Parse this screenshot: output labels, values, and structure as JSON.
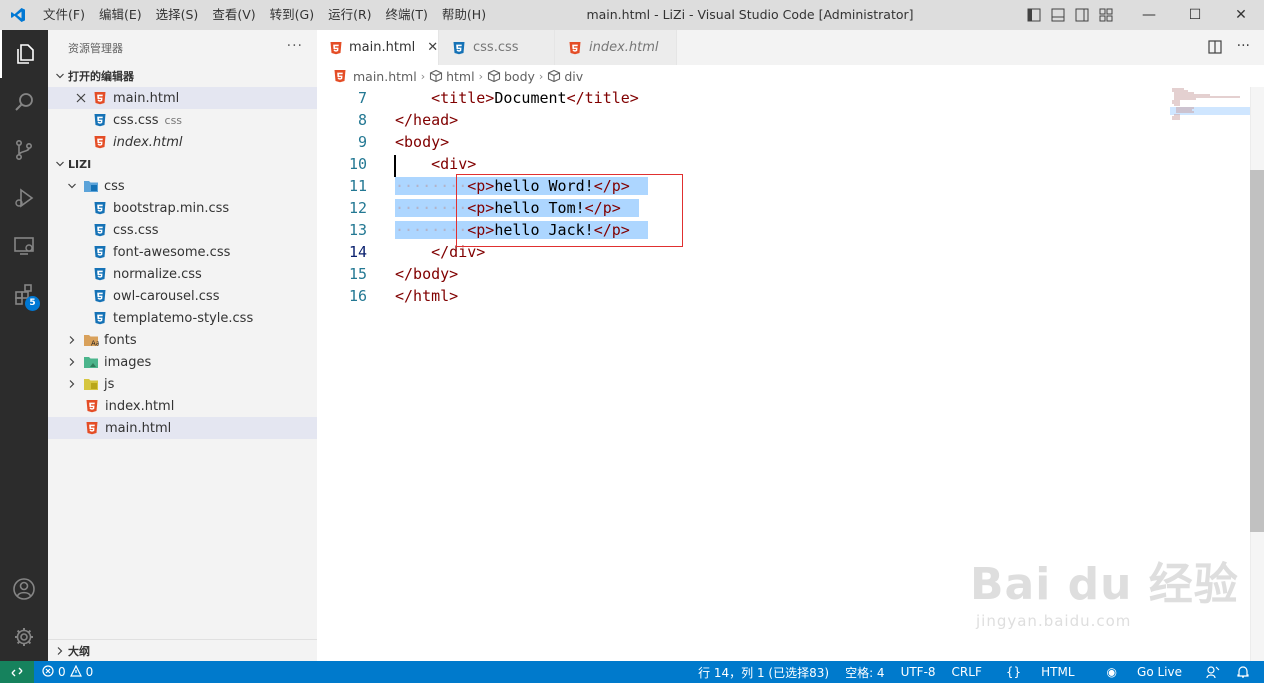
{
  "titlebar": {
    "menu": [
      "文件(F)",
      "编辑(E)",
      "选择(S)",
      "查看(V)",
      "转到(G)",
      "运行(R)",
      "终端(T)",
      "帮助(H)"
    ],
    "title": "main.html - LiZi - Visual Studio Code [Administrator]"
  },
  "activity": {
    "extensions_badge": "5"
  },
  "sidebar": {
    "header": "资源管理器",
    "open_editors_title": "打开的编辑器",
    "open_editors": [
      {
        "name": "main.html",
        "desc": ""
      },
      {
        "name": "css.css",
        "desc": "css"
      },
      {
        "name": "index.html",
        "desc": ""
      }
    ],
    "project_title": "LIZI",
    "tree": {
      "css_folder": "css",
      "css_files": [
        "bootstrap.min.css",
        "css.css",
        "font-awesome.css",
        "normalize.css",
        "owl-carousel.css",
        "templatemo-style.css"
      ],
      "folders": [
        "fonts",
        "images",
        "js"
      ],
      "files": [
        "index.html",
        "main.html"
      ]
    },
    "outline_title": "大纲"
  },
  "tabs": [
    {
      "label": "main.html"
    },
    {
      "label": "css.css"
    },
    {
      "label": "index.html"
    }
  ],
  "breadcrumb": [
    "main.html",
    "html",
    "body",
    "div"
  ],
  "editor": {
    "line_numbers": [
      "7",
      "8",
      "9",
      "10",
      "11",
      "12",
      "13",
      "14",
      "15",
      "16"
    ],
    "lines": {
      "l7_open": "<title>",
      "l7_text": "Document",
      "l7_close": "</title>",
      "l8": "</head>",
      "l9": "<body>",
      "l10": "<div>",
      "l11_open": "<p>",
      "l11_text": "hello Word!",
      "l11_close": "</p>",
      "l12_open": "<p>",
      "l12_text": "hello Tom!",
      "l12_close": "</p>",
      "l13_open": "<p>",
      "l13_text": "hello Jack!",
      "l13_close": "</p>",
      "l14": "</div>",
      "l15": "</body>",
      "l16": "</html>"
    }
  },
  "statusbar": {
    "errors": "0",
    "warnings": "0",
    "position": "行 14，列 1 (已选择83)",
    "spaces": "空格: 4",
    "encoding": "UTF-8",
    "eol": "CRLF",
    "language": "HTML",
    "golive": "Go Live"
  },
  "watermark": {
    "brand": "Bai du 经验",
    "url": "jingyan.baidu.com"
  },
  "colors": {
    "activity_bg": "#2c2c2c",
    "statusbar_bg": "#007acc",
    "selection": "#add6ff",
    "tag": "#800000",
    "html_icon": "#e44d26",
    "css_icon": "#1572b6"
  }
}
